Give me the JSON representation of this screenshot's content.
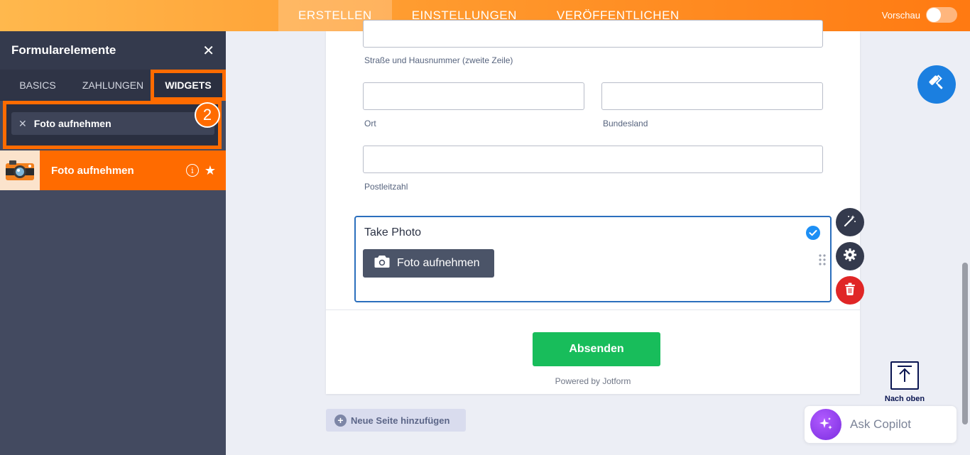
{
  "topbar": {
    "tabs": [
      {
        "label": "ERSTELLEN",
        "active": true
      },
      {
        "label": "EINSTELLUNGEN",
        "active": false
      },
      {
        "label": "VERÖFFENTLICHEN",
        "active": false
      }
    ],
    "preview_label": "Vorschau",
    "colors": {
      "from": "#ffb84d",
      "to": "#ff7a12"
    }
  },
  "sidebar": {
    "title": "Formularelemente",
    "tabs": {
      "basics": "BASICS",
      "payments": "ZAHLUNGEN",
      "widgets": "WIDGETS"
    },
    "search_value": "Foto aufnehmen",
    "step_number": "2",
    "result": {
      "label": "Foto aufnehmen",
      "icon": "camera-thumbnail"
    },
    "highlight_color": "#ff6b00"
  },
  "form": {
    "labels": {
      "street2": "Straße und Hausnummer (zweite Zeile)",
      "city": "Ort",
      "state": "Bundesland",
      "zip": "Postleitzahl"
    },
    "photo_field": {
      "title": "Take Photo",
      "button_label": "Foto aufnehmen"
    },
    "submit_label": "Absenden",
    "powered_by": "Powered by Jotform",
    "submit_color": "#18bd5b"
  },
  "actions": {
    "add_page": "Neue Seite hinzufügen",
    "back_to_top": "Nach oben",
    "copilot": "Ask Copilot"
  }
}
